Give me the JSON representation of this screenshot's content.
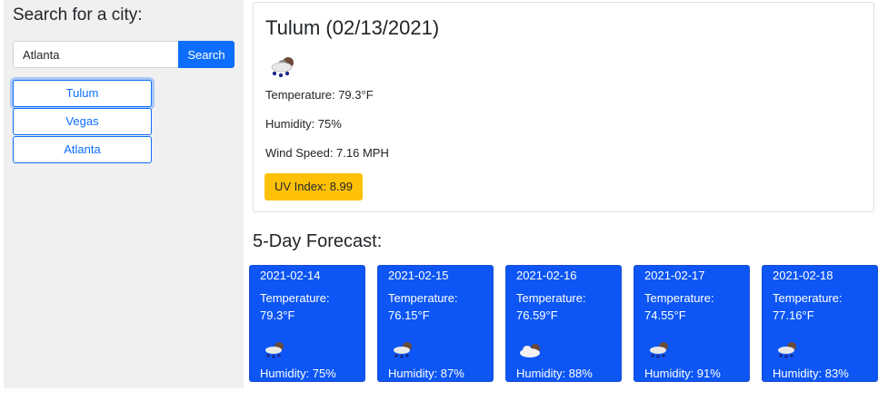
{
  "search": {
    "title": "Search for a city:",
    "input_value": "Atlanta",
    "button_label": "Search"
  },
  "history": [
    {
      "label": "Tulum"
    },
    {
      "label": "Vegas"
    },
    {
      "label": "Atlanta"
    }
  ],
  "current": {
    "title": "Tulum (02/13/2021)",
    "icon": "snow-rain-icon",
    "temperature": "Temperature: 79.3°F",
    "humidity": "Humidity: 75%",
    "wind": "Wind Speed: 7.16 MPH",
    "uv": "UV Index: 8.99"
  },
  "forecast": {
    "title": "5-Day Forecast:",
    "temperature_label": "Temperature:",
    "days": [
      {
        "date": "2021-02-14",
        "temp": "79.3°F",
        "humidity": "Humidity: 75%",
        "icon": "snow-rain-icon"
      },
      {
        "date": "2021-02-15",
        "temp": "76.15°F",
        "humidity": "Humidity: 87%",
        "icon": "snow-rain-icon"
      },
      {
        "date": "2021-02-16",
        "temp": "76.59°F",
        "humidity": "Humidity: 88%",
        "icon": "cloud-icon"
      },
      {
        "date": "2021-02-17",
        "temp": "74.55°F",
        "humidity": "Humidity: 91%",
        "icon": "snow-rain-icon"
      },
      {
        "date": "2021-02-18",
        "temp": "77.16°F",
        "humidity": "Humidity: 83%",
        "icon": "snow-rain-icon"
      }
    ]
  },
  "colors": {
    "primary": "#0d6efd",
    "forecast_bg": "#0d56f5",
    "uv_bg": "#ffc107",
    "sidebar_bg": "#f0f0f0"
  }
}
